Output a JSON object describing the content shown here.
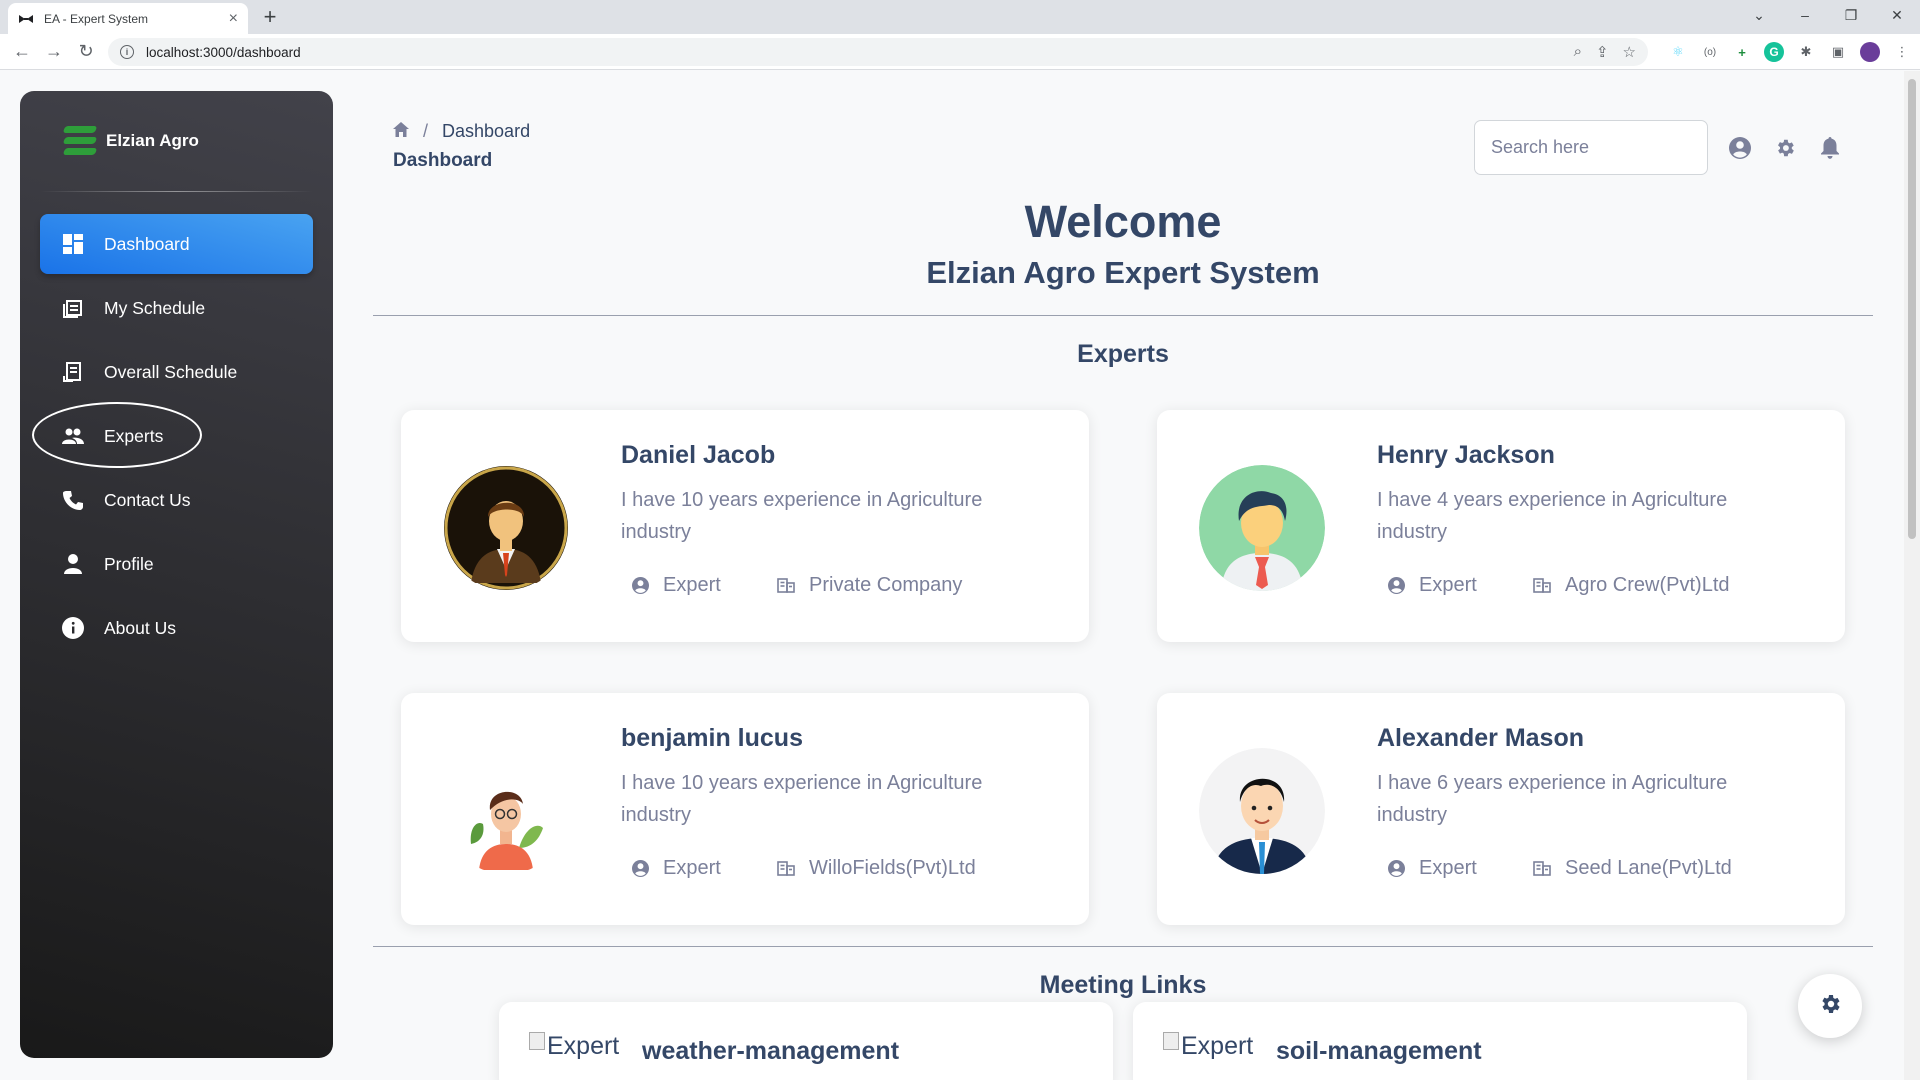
{
  "browser": {
    "tab_title": "EA - Expert System",
    "url": "localhost:3000/dashboard"
  },
  "sidebar": {
    "brand": "Elzian Agro",
    "items": [
      {
        "label": "Dashboard",
        "icon": "dashboard-icon",
        "active": true
      },
      {
        "label": "My Schedule",
        "icon": "schedule-icon",
        "active": false
      },
      {
        "label": "Overall Schedule",
        "icon": "receipt-icon",
        "active": false
      },
      {
        "label": "Experts",
        "icon": "people-icon",
        "active": false,
        "highlighted": true
      },
      {
        "label": "Contact Us",
        "icon": "phone-icon",
        "active": false
      },
      {
        "label": "Profile",
        "icon": "person-icon",
        "active": false
      },
      {
        "label": "About Us",
        "icon": "info-icon",
        "active": false
      }
    ]
  },
  "header": {
    "breadcrumb_current": "Dashboard",
    "page_title": "Dashboard",
    "search_placeholder": "Search here"
  },
  "main": {
    "welcome": "Welcome",
    "subtitle": "Elzian Agro Expert System",
    "experts_title": "Experts",
    "experts": [
      {
        "name": "Daniel Jacob",
        "bio": "I have 10 years experience in Agriculture industry",
        "role": "Expert",
        "company": "Private Company"
      },
      {
        "name": "Henry Jackson",
        "bio": "I have 4 years experience in Agriculture industry",
        "role": "Expert",
        "company": "Agro Crew(Pvt)Ltd"
      },
      {
        "name": "benjamin lucus",
        "bio": "I have 10 years experience in Agriculture industry",
        "role": "Expert",
        "company": "WilloFields(Pvt)Ltd"
      },
      {
        "name": "Alexander Mason",
        "bio": "I have 6 years experience in Agriculture industry",
        "role": "Expert",
        "company": "Seed Lane(Pvt)Ltd"
      }
    ],
    "meeting_title": "Meeting Links",
    "meetings": [
      {
        "alt": "Expert",
        "title": "weather-management"
      },
      {
        "alt": "Expert",
        "title": "soil-management"
      }
    ]
  },
  "colors": {
    "active_nav": "#1a73e8",
    "text_dark": "#344767",
    "text_muted": "#7b809a"
  }
}
